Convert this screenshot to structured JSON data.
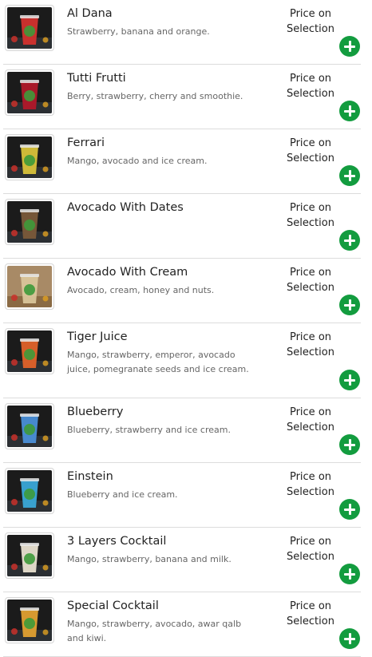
{
  "menu": {
    "items": [
      {
        "name": "Al Dana",
        "description": "Strawberry, banana and orange.",
        "price": "Price on Selection",
        "drink_color": "#d2322e",
        "icon": "drink-photo"
      },
      {
        "name": "Tutti Frutti",
        "description": "Berry, strawberry, cherry and smoothie.",
        "price": "Price on Selection",
        "drink_color": "#b0182a",
        "icon": "drink-photo"
      },
      {
        "name": "Ferrari",
        "description": "Mango, avocado and ice cream.",
        "price": "Price on Selection",
        "drink_color": "#d8c23a",
        "icon": "drink-photo"
      },
      {
        "name": "Avocado With Dates",
        "description": "",
        "price": "Price on Selection",
        "drink_color": "#7a5a3a",
        "icon": "drink-photo"
      },
      {
        "name": "Avocado With Cream",
        "description": "Avocado, cream, honey and nuts.",
        "price": "Price on Selection",
        "drink_color": "#d9c59a",
        "icon": "drink-photo"
      },
      {
        "name": "Tiger Juice",
        "description": "Mango, strawberry, emperor, avocado juice, pomegranate seeds and ice cream.",
        "price": "Price on Selection",
        "drink_color": "#e0622a",
        "icon": "drink-photo"
      },
      {
        "name": "Blueberry",
        "description": "Blueberry, strawberry and ice cream.",
        "price": "Price on Selection",
        "drink_color": "#4a8fd8",
        "icon": "drink-photo"
      },
      {
        "name": "Einstein",
        "description": "Blueberry and ice cream.",
        "price": "Price on Selection",
        "drink_color": "#3aa8d8",
        "icon": "drink-photo"
      },
      {
        "name": "3 Layers Cocktail",
        "description": "Mango, strawberry, banana and milk.",
        "price": "Price on Selection",
        "drink_color": "#e8e0d0",
        "icon": "drink-photo"
      },
      {
        "name": "Special Cocktail",
        "description": "Mango, strawberry, avocado, awar qalb and kiwi.",
        "price": "Price on Selection",
        "drink_color": "#e0a032",
        "icon": "drink-photo"
      }
    ]
  },
  "colors": {
    "add_button": "#139c3f",
    "divider": "#dcdcdc"
  }
}
